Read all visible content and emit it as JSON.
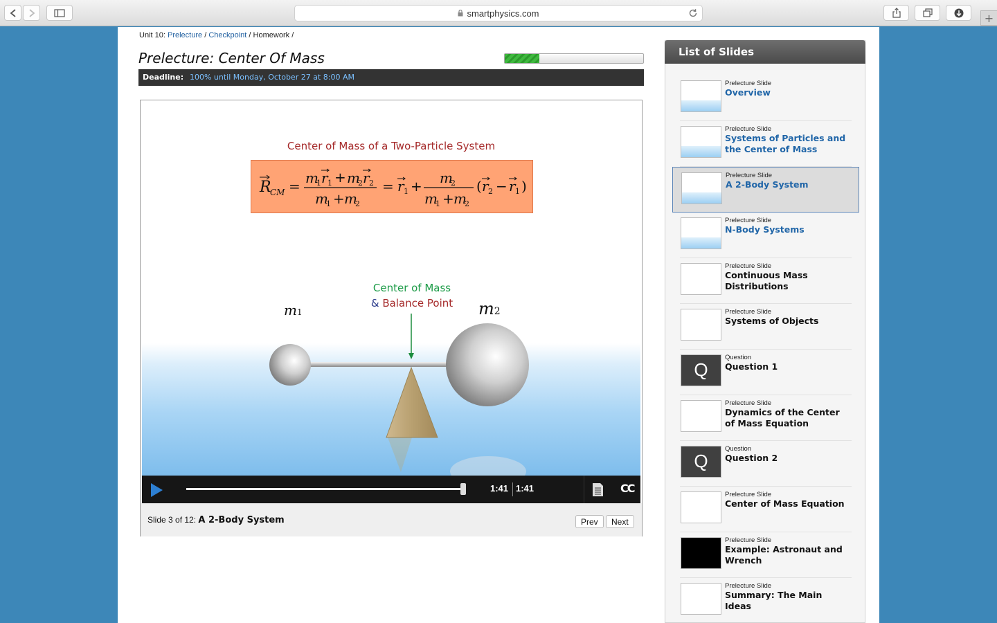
{
  "browser": {
    "url": "smartphysics.com",
    "new_tab_label": "+"
  },
  "breadcrumb": {
    "unit": "Unit 10:",
    "prelecture": "Prelecture",
    "checkpoint": "Checkpoint",
    "homework": "Homework",
    "separator": "/"
  },
  "page_title": "Prelecture: Center Of Mass",
  "progress_fraction": 0.25,
  "deadline": {
    "label": "Deadline:",
    "value": "100% until Monday, October 27 at 8:00 AM"
  },
  "slide": {
    "title": "Center of Mass  of a Two-Particle System",
    "com_label": "Center of Mass",
    "balance_amp": "&",
    "balance_label": "Balance Point",
    "m1_label": "m",
    "m1_sub": "1",
    "m2_label": "m",
    "m2_sub": "2"
  },
  "player": {
    "time_current": "1:41",
    "time_total": "1:41",
    "cc_label": "CC",
    "seek_fraction": 0.995
  },
  "footer": {
    "status_prefix": "Slide 3 of 12:",
    "status_title": "A 2-Body System",
    "prev": "Prev",
    "next": "Next"
  },
  "sidebar": {
    "header": "List of Slides",
    "items": [
      {
        "type": "Prelecture Slide",
        "title": "Overview",
        "link": true,
        "thumb": "sky"
      },
      {
        "type": "Prelecture Slide",
        "title": "Systems of Particles and the Center of Mass",
        "link": true,
        "thumb": "sky"
      },
      {
        "type": "Prelecture Slide",
        "title": "A 2-Body System",
        "link": true,
        "thumb": "sky",
        "active": true
      },
      {
        "type": "Prelecture Slide",
        "title": "N-Body Systems",
        "link": true,
        "thumb": "sky"
      },
      {
        "type": "Prelecture Slide",
        "title": "Continuous Mass Distributions",
        "link": false,
        "thumb": "plain"
      },
      {
        "type": "Prelecture Slide",
        "title": "Systems of Objects",
        "link": false,
        "thumb": "plain"
      },
      {
        "type": "Question",
        "title": "Question 1",
        "link": false,
        "thumb": "question",
        "q_letter": "Q"
      },
      {
        "type": "Prelecture Slide",
        "title": "Dynamics of the Center of Mass Equation",
        "link": false,
        "thumb": "plain"
      },
      {
        "type": "Question",
        "title": "Question 2",
        "link": false,
        "thumb": "question",
        "q_letter": "Q"
      },
      {
        "type": "Prelecture Slide",
        "title": "Center of Mass Equation",
        "link": false,
        "thumb": "plain"
      },
      {
        "type": "Prelecture Slide",
        "title": "Example: Astronaut and Wrench",
        "link": false,
        "thumb": "dark"
      },
      {
        "type": "Prelecture Slide",
        "title": "Summary: The Main Ideas",
        "link": false,
        "thumb": "plain"
      }
    ]
  },
  "colors": {
    "link": "#1f5fa0",
    "progress": "#3fb93f",
    "formula_box": "#ffa374",
    "com_label": "#1c9b47",
    "balance_label": "#a52a2a"
  }
}
